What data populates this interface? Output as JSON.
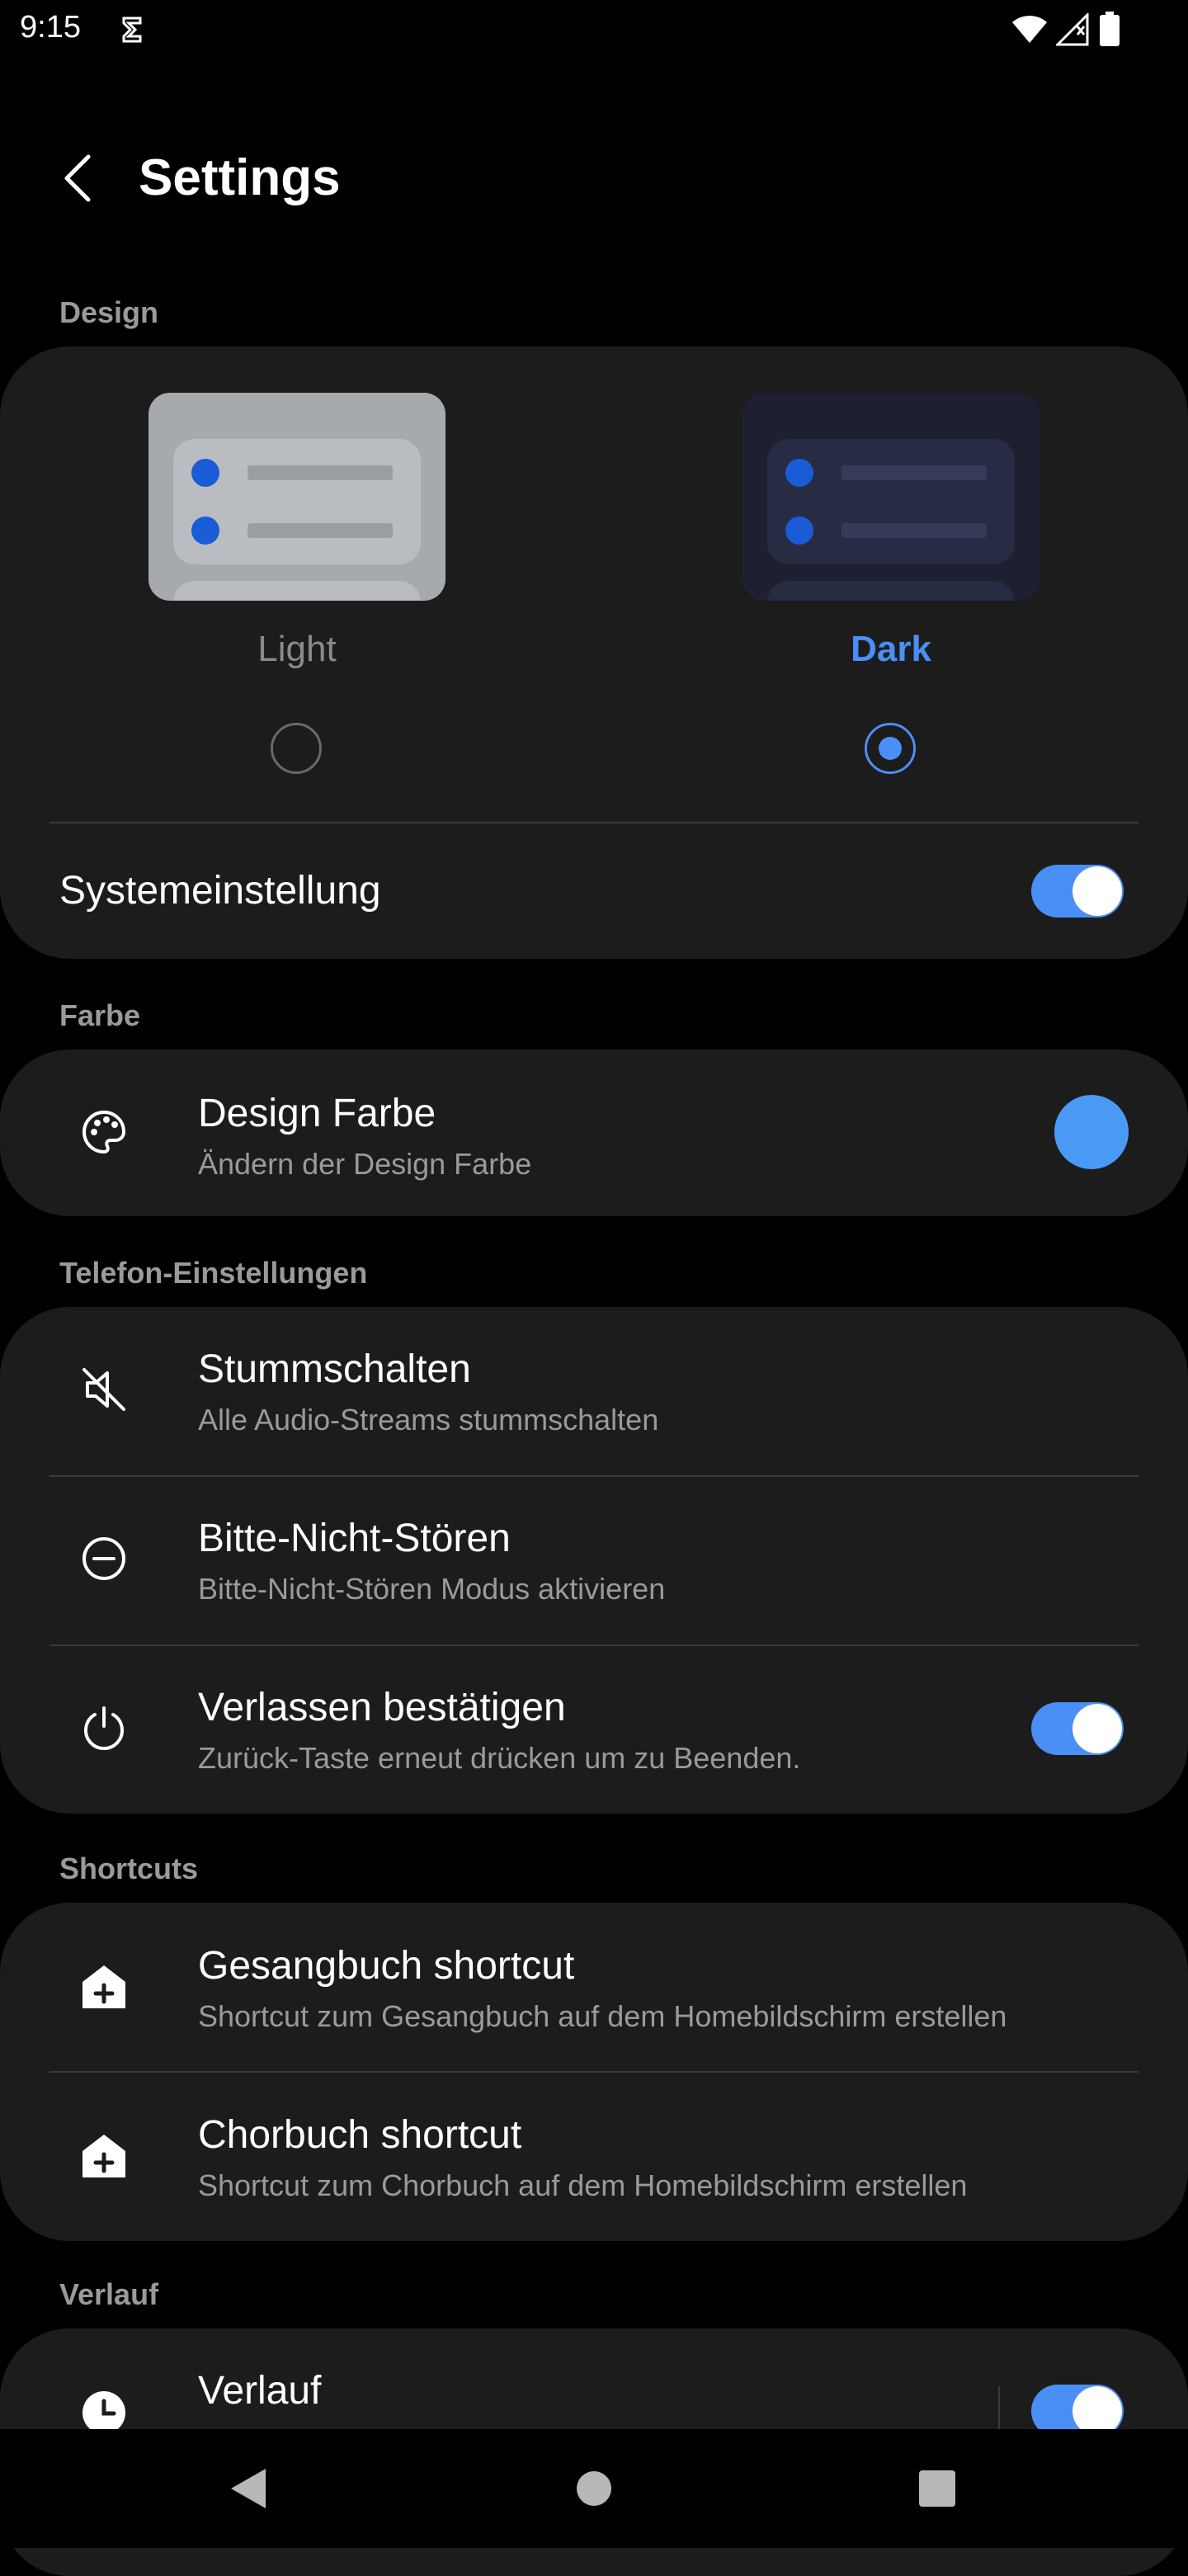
{
  "status_bar": {
    "time": "9:15"
  },
  "app_bar": {
    "title": "Settings"
  },
  "sections": {
    "design": "Design",
    "color": "Farbe",
    "phone": "Telefon-Einstellungen",
    "shortcuts": "Shortcuts",
    "history": "Verlauf"
  },
  "design": {
    "light_label": "Light",
    "dark_label": "Dark",
    "selected": "dark",
    "system_setting_label": "Systemeinstellung",
    "system_setting_on": true
  },
  "color": {
    "title": "Design Farbe",
    "subtitle": "Ändern der Design Farbe",
    "swatch_color": "#4a9af5"
  },
  "phone": {
    "mute_title": "Stummschalten",
    "mute_sub": "Alle Audio-Streams stummschalten",
    "dnd_title": "Bitte-Nicht-Stören",
    "dnd_sub": "Bitte-Nicht-Stören Modus aktivieren",
    "exit_title": "Verlassen bestätigen",
    "exit_sub": "Zurück-Taste erneut drücken um zu Beenden.",
    "exit_on": true
  },
  "shortcuts": {
    "hymnal_title": "Gesangbuch shortcut",
    "hymnal_sub": "Shortcut zum Gesangbuch auf dem Homebildschirm erstellen",
    "choir_title": "Chorbuch shortcut",
    "choir_sub": "Shortcut zum Chorbuch auf dem Homebildschirm erstellen"
  },
  "history": {
    "title": "Verlauf",
    "on": true
  },
  "colors": {
    "accent": "#4a8ff5",
    "card": "#1c1c1c",
    "background": "#000000",
    "secondary_text": "#9a9a9a"
  }
}
